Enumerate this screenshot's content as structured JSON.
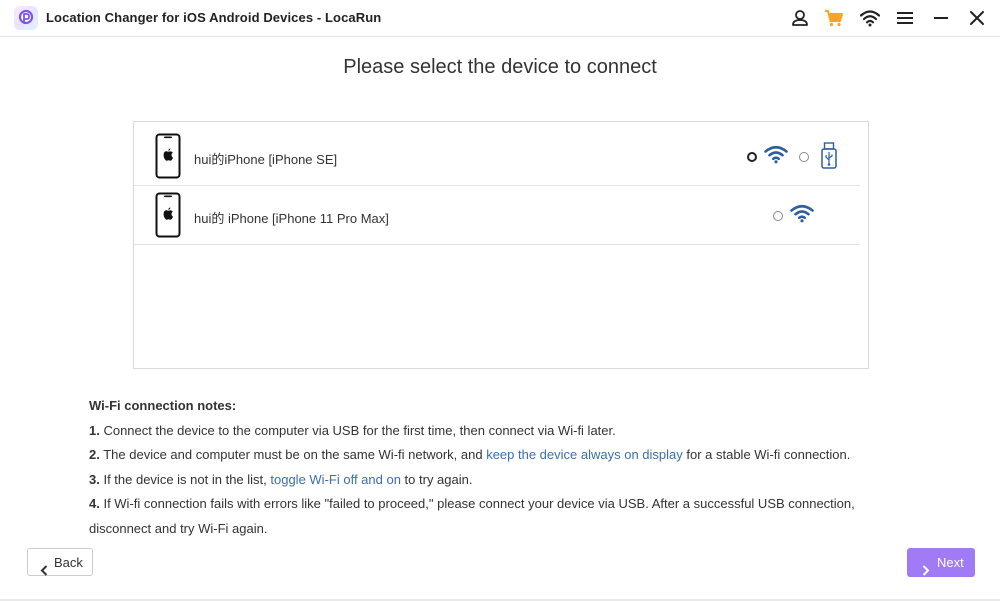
{
  "titlebar": {
    "title": "Location Changer for iOS  Android Devices - LocaRun",
    "icons": [
      "user-icon",
      "cart-icon",
      "wifi-icon",
      "menu-icon",
      "minimize-icon",
      "close-icon"
    ]
  },
  "heading": "Please select the device to connect",
  "devices": [
    {
      "name": "hui的iPhone [iPhone SE]",
      "wifi_selected": true,
      "usb_available": true
    },
    {
      "name": "hui的 iPhone [iPhone 11 Pro Max]",
      "wifi_selected": false,
      "usb_available": false
    }
  ],
  "notes": {
    "title": "Wi-Fi connection notes:",
    "items": [
      {
        "num": "1.",
        "text1": " Connect the device to the computer via USB for the first time, then connect via Wi-fi later."
      },
      {
        "num": "2.",
        "text1": " The device and computer must be on the same Wi-fi network, and ",
        "link": "keep the device always on display",
        "text2": " for a stable Wi-fi connection."
      },
      {
        "num": "3.",
        "text1": " If the device is not in the list, ",
        "link": "toggle Wi-Fi off and on",
        "text2": " to try again."
      },
      {
        "num": "4.",
        "text1": " If Wi-fi connection fails with errors like \"failed to proceed,\" please connect your device via USB. After a successful USB connection, disconnect and try Wi-Fi again."
      }
    ]
  },
  "buttons": {
    "back": "Back",
    "next": "Next"
  },
  "colors": {
    "accent": "#a17af5",
    "link": "#3a6fb0",
    "wifi_icon": "#2f5f9e",
    "cart": "#f5a623"
  }
}
